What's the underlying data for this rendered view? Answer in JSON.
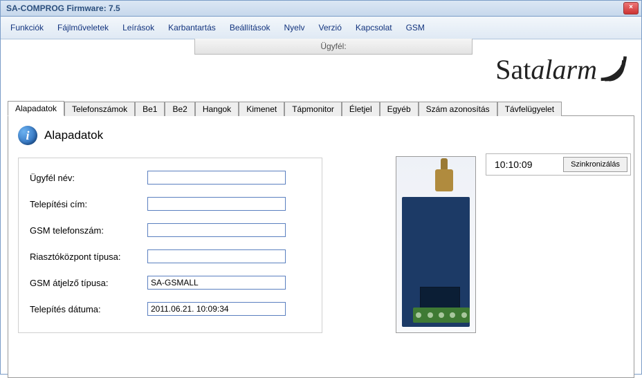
{
  "window": {
    "title": "SA-COMPROG Firmware: 7.5"
  },
  "menu": {
    "items": [
      "Funkciók",
      "Fájlműveletek",
      "Leírások",
      "Karbantartás",
      "Beállítások",
      "Nyelv",
      "Verzió",
      "Kapcsolat",
      "GSM"
    ]
  },
  "ugyfel_strip": {
    "label": "Ügyfél:"
  },
  "logo": {
    "part1": "Sat",
    "part2": "alarm"
  },
  "tabs": [
    "Alapadatok",
    "Telefonszámok",
    "Be1",
    "Be2",
    "Hangok",
    "Kimenet",
    "Tápmonitor",
    "Életjel",
    "Egyéb",
    "Szám azonosítás",
    "Távfelügyelet"
  ],
  "active_tab_index": 0,
  "panel": {
    "title": "Alapadatok",
    "info_glyph": "i",
    "fields": {
      "ugyfel_nev": {
        "label": "Ügyfél név:",
        "value": ""
      },
      "telepitesi_cim": {
        "label": "Telepítési cím:",
        "value": ""
      },
      "gsm_telefonszam": {
        "label": "GSM telefonszám:",
        "value": ""
      },
      "riasztokozpont": {
        "label": "Riasztóközpont típusa:",
        "value": ""
      },
      "gsm_atjelzo": {
        "label": "GSM átjelző típusa:",
        "value": "SA-GSMALL"
      },
      "telepites_datum": {
        "label": "Telepítés dátuma:",
        "value": "2011.06.21. 10:09:34"
      }
    }
  },
  "clock": {
    "time": "10:10:09",
    "sync_label": "Szinkronizálás"
  }
}
